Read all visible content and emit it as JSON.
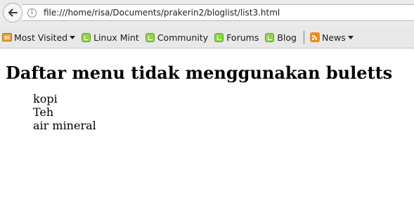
{
  "browser": {
    "url": "file:///home/risa/Documents/prakerin2/bloglist/list3.html",
    "bookmarks": [
      {
        "label": "Most Visited",
        "icon": "folder-icon",
        "dropdown": true
      },
      {
        "label": "Linux Mint",
        "icon": "mint-icon"
      },
      {
        "label": "Community",
        "icon": "mint-icon"
      },
      {
        "label": "Forums",
        "icon": "mint-icon"
      },
      {
        "label": "Blog",
        "icon": "mint-icon"
      },
      {
        "label": "News",
        "icon": "rss-icon",
        "dropdown": true
      }
    ]
  },
  "page": {
    "title": "Daftar menu tidak menggunakan buletts",
    "menu_items": [
      "kopi",
      "Teh",
      "air mineral"
    ]
  }
}
